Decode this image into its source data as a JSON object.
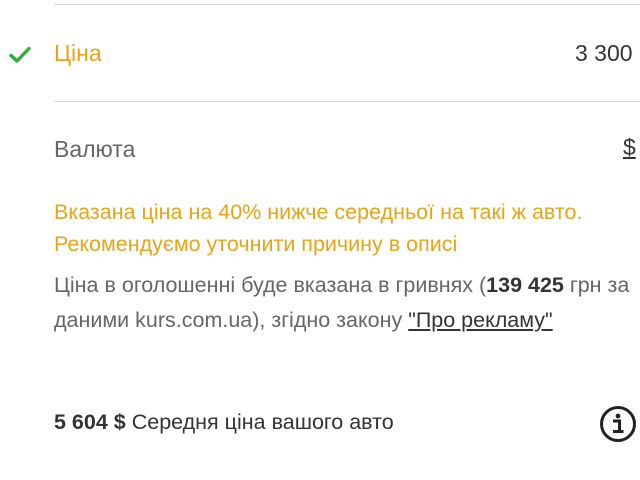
{
  "price": {
    "label": "Ціна",
    "value": "3 300",
    "status_icon": "check-icon",
    "status_color": "#2eae3a"
  },
  "currency": {
    "label": "Валюта",
    "selected": "$"
  },
  "warning": {
    "text": "Вказана ціна на 40% нижче середньої на такі ж авто. Рекомендуємо уточнити причину в описі",
    "color": "#e8a317"
  },
  "conversion": {
    "text_before": "Ціна в оголошенні буде вказана в гривнях (",
    "uah_amount": "139 425",
    "text_middle": " грн за даними kurs.com.ua), згідно закону ",
    "law_link": "\"Про рекламу\""
  },
  "average": {
    "amount": "5 604 $",
    "text": " Середня ціна вашого авто",
    "info_icon": "info-icon"
  }
}
